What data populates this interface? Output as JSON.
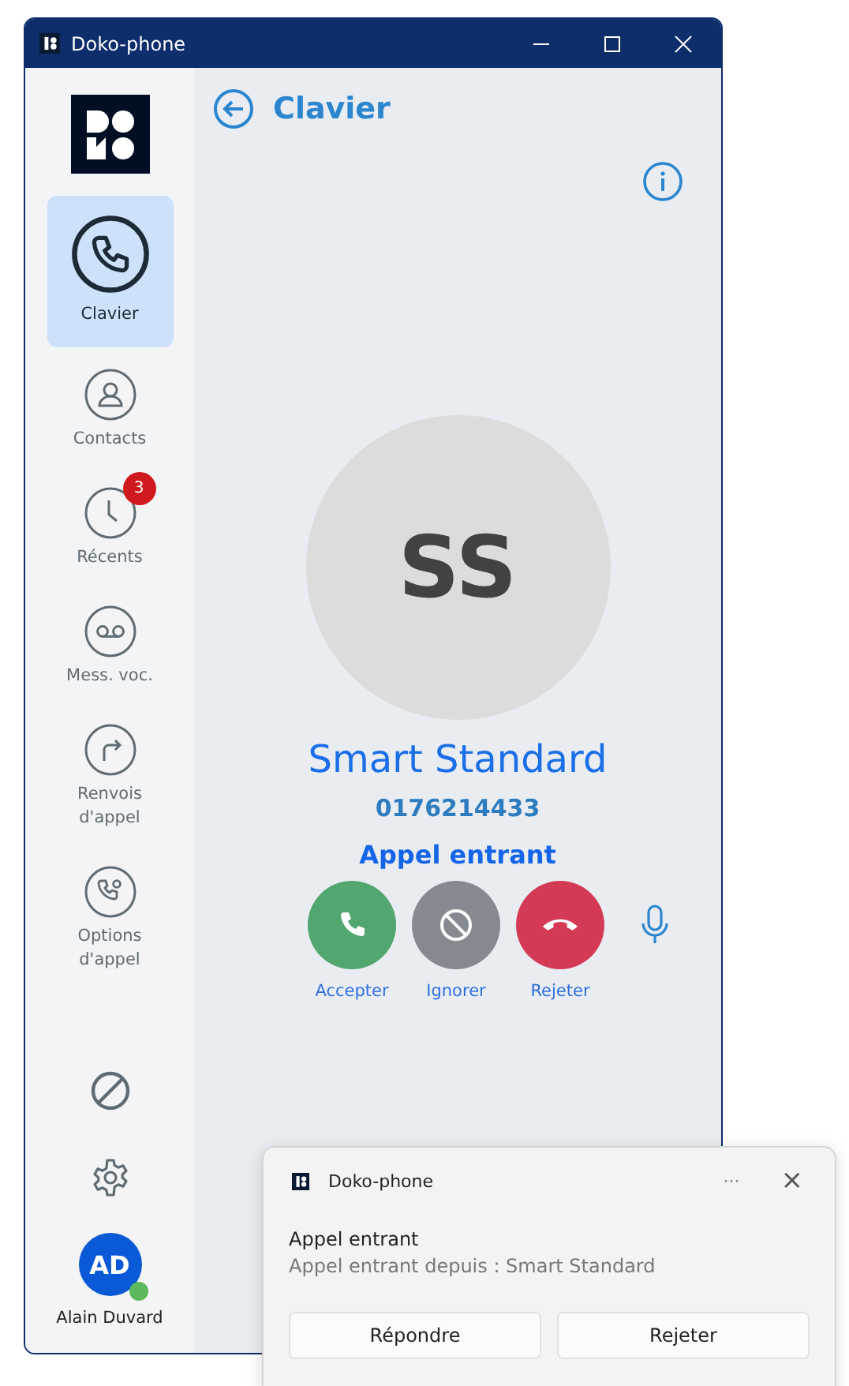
{
  "window": {
    "title": "Doko-phone"
  },
  "header": {
    "title": "Clavier"
  },
  "sidebar": {
    "items": [
      {
        "kind": "phone",
        "label": "Clavier",
        "selected": true
      },
      {
        "kind": "contact",
        "label": "Contacts",
        "selected": false
      },
      {
        "kind": "clock",
        "label": "Récents",
        "selected": false,
        "badge": "3"
      },
      {
        "kind": "voicemail",
        "label": "Mess. voc.",
        "selected": false
      },
      {
        "kind": "forward",
        "label": "Renvois d'appel",
        "selected": false
      },
      {
        "kind": "options",
        "label": "Options d'appel",
        "selected": false
      }
    ],
    "user": {
      "initials": "AD",
      "name": "Alain Duvard",
      "color": "#5cb85c"
    }
  },
  "caller": {
    "initials": "SS",
    "name": "Smart Standard",
    "number": "0176214433",
    "status": "Appel entrant"
  },
  "actions": [
    {
      "kind": "accept",
      "label": "Accepter",
      "color": "#52a66f"
    },
    {
      "kind": "ignore",
      "label": "Ignorer",
      "color": "#858a91"
    },
    {
      "kind": "reject",
      "label": "Rejeter",
      "color": "#d43a55"
    }
  ],
  "notification": {
    "app": "Doko-phone",
    "more": "···",
    "close": "×",
    "title": "Appel entrant",
    "body": "Appel entrant depuis : Smart Standard",
    "buttons": [
      "Répondre",
      "Rejeter"
    ]
  }
}
